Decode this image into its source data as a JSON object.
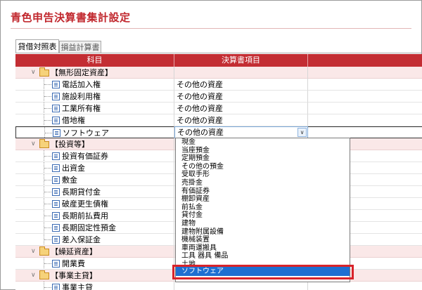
{
  "title": "青色申告決算書集計設定",
  "tabs": [
    {
      "label": "貸借対照表"
    },
    {
      "label": "損益計算書"
    }
  ],
  "columns": {
    "subject": "科目",
    "statement_item": "決算書項目"
  },
  "rows": [
    {
      "type": "category",
      "label": "【無形固定資産】"
    },
    {
      "type": "item",
      "label": "電話加入権",
      "value": "その他の資産"
    },
    {
      "type": "item",
      "label": "施設利用権",
      "value": "その他の資産"
    },
    {
      "type": "item",
      "label": "工業所有権",
      "value": "その他の資産"
    },
    {
      "type": "item",
      "label": "借地権",
      "value": "その他の資産"
    },
    {
      "type": "item",
      "label": "ソフトウェア",
      "value": "その他の資産"
    },
    {
      "type": "category",
      "label": "【投資等】"
    },
    {
      "type": "item",
      "label": "投資有価証券",
      "value": ""
    },
    {
      "type": "item",
      "label": "出資金",
      "value": ""
    },
    {
      "type": "item",
      "label": "敷金",
      "value": ""
    },
    {
      "type": "item",
      "label": "長期貸付金",
      "value": ""
    },
    {
      "type": "item",
      "label": "破産更生債権",
      "value": ""
    },
    {
      "type": "item",
      "label": "長期前払費用",
      "value": ""
    },
    {
      "type": "item",
      "label": "長期固定性預金",
      "value": ""
    },
    {
      "type": "item",
      "label": "差入保証金",
      "value": ""
    },
    {
      "type": "category",
      "label": "【繰延資産】"
    },
    {
      "type": "item",
      "label": "開業費",
      "value": ""
    },
    {
      "type": "category",
      "label": "【事業主貸】"
    },
    {
      "type": "item",
      "label": "事業主貸",
      "value": ""
    }
  ],
  "dropdown_options": [
    "現金",
    "当座預金",
    "定期預金",
    "その他の預金",
    "受取手形",
    "売掛金",
    "有価証券",
    "棚卸資産",
    "前払金",
    "貸付金",
    "建物",
    "建物附属設備",
    "機械装置",
    "車両運搬具",
    "工具 器具 備品",
    "土地",
    "ソフトウェア"
  ],
  "selected_option": "ソフトウェア",
  "colors": {
    "title": "#c1272d",
    "header_bg": "#c32d33",
    "category_bg": "#fae8e8",
    "selection": "#1e6fd1",
    "highlight_box": "#d8232a"
  }
}
